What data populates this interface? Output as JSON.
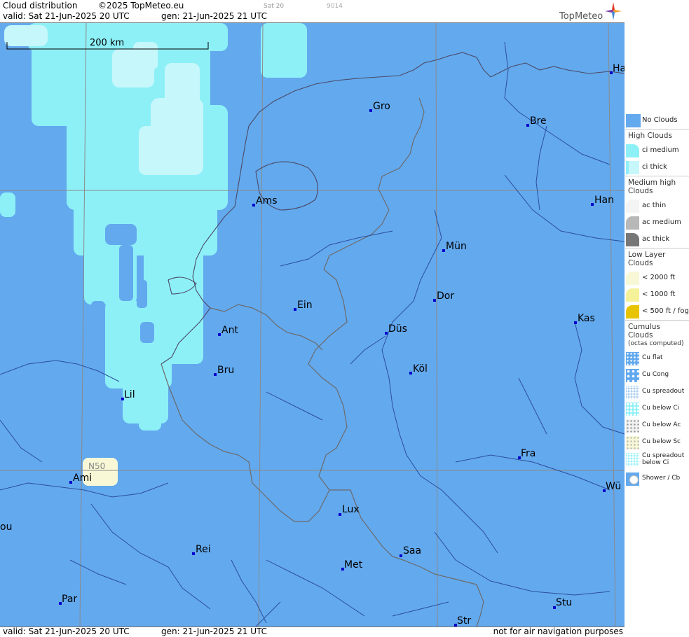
{
  "header": {
    "title": "Cloud distribution",
    "copyright": "©2025 TopMeteo.eu",
    "sat_label": "Sat 20",
    "code": "9014",
    "valid": "valid:  Sat  21-Jun-2025  20 UTC",
    "generated": "gen: 21-Jun-2025 21 UTC",
    "brand": "TopMeteo"
  },
  "footer": {
    "valid": "valid:  Sat  21-Jun-2025  20 UTC",
    "generated": "gen: 21-Jun-2025 21 UTC",
    "note": "not for air navigation purposes"
  },
  "map": {
    "scale_label": "200 km",
    "lat_label": "N50",
    "colors": {
      "no_clouds": "#63a9ee",
      "ci_medium": "#8ef0f7",
      "ci_thick": "#c6f7fb",
      "low_cloud": "#f8f8d6",
      "city_dot": "#0000cc"
    },
    "cities": [
      {
        "name": "Gro"
      },
      {
        "name": "Bre"
      },
      {
        "name": "Ha"
      },
      {
        "name": "Ams"
      },
      {
        "name": "Han"
      },
      {
        "name": "Mün"
      },
      {
        "name": "Ein"
      },
      {
        "name": "Dor"
      },
      {
        "name": "Kas"
      },
      {
        "name": "Ant"
      },
      {
        "name": "Düs"
      },
      {
        "name": "Bru"
      },
      {
        "name": "Köl"
      },
      {
        "name": "Lil"
      },
      {
        "name": "Fra"
      },
      {
        "name": "Ami"
      },
      {
        "name": "Wü"
      },
      {
        "name": "ou"
      },
      {
        "name": "Lux"
      },
      {
        "name": "Rei"
      },
      {
        "name": "Saa"
      },
      {
        "name": "Met"
      },
      {
        "name": "Par"
      },
      {
        "name": "Stu"
      },
      {
        "name": "Str"
      }
    ]
  },
  "legend": {
    "no_clouds": "No Clouds",
    "high_head": "High Clouds",
    "ci_medium": "ci medium",
    "ci_thick": "ci thick",
    "medium_head": "Medium high Clouds",
    "ac_thin": "ac thin",
    "ac_medium": "ac medium",
    "ac_thick": "ac thick",
    "low_head": "Low Layer Clouds",
    "low_2000": "< 2000 ft",
    "low_1000": "< 1000 ft",
    "low_500": "< 500 ft / fog",
    "cu_head": "Cumulus Clouds",
    "cu_sub": "(octas computed)",
    "cu_flat": "Cu flat",
    "cu_cong": "Cu Cong",
    "cu_spread": "Cu spreadout",
    "cu_below_ci": "Cu below Ci",
    "cu_below_ac": "Cu below Ac",
    "cu_below_sc": "Cu below Sc",
    "cu_spread_ci": "Cu spreadout below Ci",
    "shower": "Shower / Cb"
  }
}
